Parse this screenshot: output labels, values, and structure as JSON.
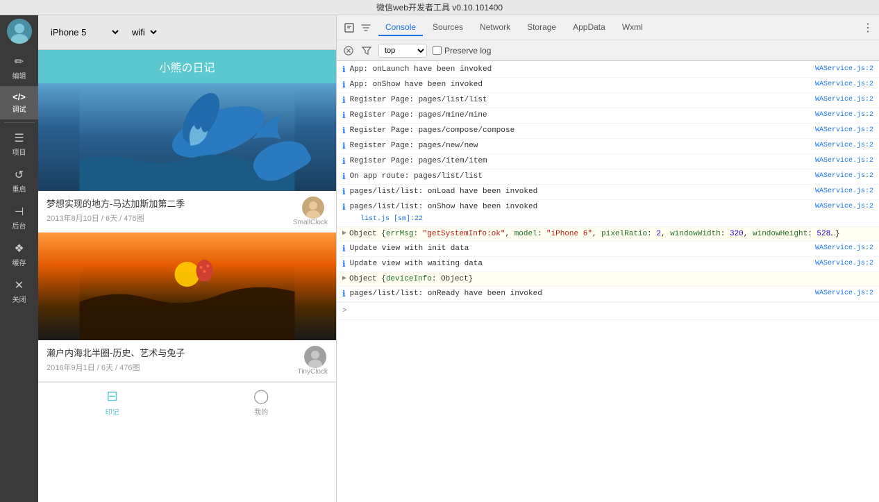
{
  "titleBar": {
    "text": "微信web开发者工具 v0.10.101400"
  },
  "leftSidebar": {
    "tools": [
      {
        "id": "edit",
        "label": "编辑",
        "icon": "✏️"
      },
      {
        "id": "debug",
        "label": "调试",
        "icon": "</>",
        "active": true
      },
      {
        "id": "project",
        "label": "项目",
        "icon": "≡"
      },
      {
        "id": "restart",
        "label": "重启",
        "icon": "↺"
      },
      {
        "id": "backend",
        "label": "后台",
        "icon": "⊣"
      },
      {
        "id": "cache",
        "label": "缓存",
        "icon": "◈"
      },
      {
        "id": "close",
        "label": "关闭",
        "icon": "✕"
      }
    ]
  },
  "phone": {
    "deviceLabel": "iPhone 5",
    "networkLabel": "wifi",
    "appTitle": "小熊の日记",
    "posts": [
      {
        "title": "梦想实现的地方-马达加斯加第二季",
        "date": "2013年8月10日 / 6天 / 476图",
        "author": "SmallClock",
        "imageType": "whale"
      },
      {
        "title": "濑户内海北半圈-历史、艺术与兔子",
        "date": "2016年9月1日 / 6天 / 476图",
        "author": "TinyClock",
        "imageType": "sunset"
      }
    ],
    "bottomNav": [
      {
        "id": "yinj",
        "label": "印记",
        "icon": "⊟",
        "active": true
      },
      {
        "id": "mine",
        "label": "我的",
        "icon": "◯"
      }
    ]
  },
  "devtools": {
    "tabs": [
      {
        "id": "console",
        "label": "Console",
        "active": true
      },
      {
        "id": "sources",
        "label": "Sources"
      },
      {
        "id": "network",
        "label": "Network"
      },
      {
        "id": "storage",
        "label": "Storage"
      },
      {
        "id": "appdata",
        "label": "AppData"
      },
      {
        "id": "wxml",
        "label": "Wxml"
      }
    ],
    "toolbar": {
      "filterPlaceholder": "top",
      "preserveLog": "Preserve log"
    },
    "consoleRows": [
      {
        "type": "info",
        "message": "App: onLaunch have been invoked",
        "source": "WAService.js:2"
      },
      {
        "type": "info",
        "message": "App: onShow have been invoked",
        "source": "WAService.js:2"
      },
      {
        "type": "info",
        "message": "Register Page: pages/list/list",
        "source": "WAService.js:2"
      },
      {
        "type": "info",
        "message": "Register Page: pages/mine/mine",
        "source": "WAService.js:2"
      },
      {
        "type": "info",
        "message": "Register Page: pages/compose/compose",
        "source": "WAService.js:2"
      },
      {
        "type": "info",
        "message": "Register Page: pages/new/new",
        "source": "WAService.js:2"
      },
      {
        "type": "info",
        "message": "Register Page: pages/item/item",
        "source": "WAService.js:2"
      },
      {
        "type": "info",
        "message": "On app route: pages/list/list",
        "source": "WAService.js:2"
      },
      {
        "type": "info",
        "message": "pages/list/list: onLoad have been invoked",
        "source": "WAService.js:2"
      },
      {
        "type": "info",
        "message": "pages/list/list: onShow have been invoked",
        "source": "WAService.js:2",
        "source2": "list.js [sm]:22"
      },
      {
        "type": "expand",
        "message": "Object {errMsg: \"getSystemInfo:ok\", model: \"iPhone 6\", pixelRatio: 2, windowWidth: 320, windowHeight: 528…}",
        "source": ""
      },
      {
        "type": "info",
        "message": "Update view with init data",
        "source": "WAService.js:2"
      },
      {
        "type": "info",
        "message": "Update view with waiting data",
        "source": "WAService.js:2"
      },
      {
        "type": "expand2",
        "message": "Object {deviceInfo: Object}",
        "source": ""
      },
      {
        "type": "info",
        "message": "pages/list/list: onReady have been invoked",
        "source": "WAService.js:2"
      }
    ],
    "inputPrompt": ">"
  }
}
